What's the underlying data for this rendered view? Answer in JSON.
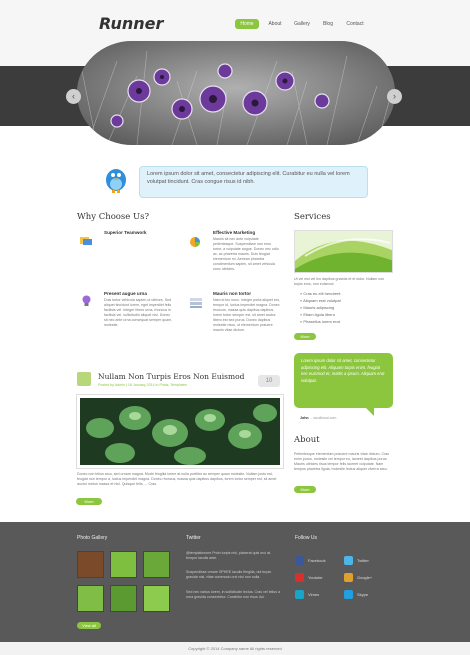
{
  "header": {
    "logo": "Runner",
    "nav": [
      "Home",
      "About",
      "Gallery",
      "Blog",
      "Contact"
    ]
  },
  "slider": {
    "prev": "‹",
    "next": "›"
  },
  "intro": "Lorem ipsum dolor sit amet, consectetur adipiscing elit. Curabitur eu nulla vel lorem volutpat tincidunt. Cras congue risus id nibh.",
  "why": {
    "heading": "Why Choose Us?",
    "features": [
      {
        "title": "Superior Teamwork",
        "text": ""
      },
      {
        "title": "Effective Marketing",
        "text": "Mauris sit nec ante vulputate pellentesque. Suspendisse non eros tortor, a vulputate augue. Donec nec odio ac, ac pharetra mauris. Duis feugiat elementum mi. Aenean pharetra condimentum sapien, sit amet vehicula nunc ultricies."
      },
      {
        "title": "Present augue urna",
        "text": "Duis tortor vehicula sapien ut ultrices. Sed aliquet tincidunt lorem, eget imperdiet felis facilisis vel. Integer libero urna, rhoncus in facilisis vel, sollicitudin aliquet nisi. Donec sit nec ante urna consequat semper quam, molestie."
      },
      {
        "title": "Mauris non tortor",
        "text": "Nam id leo nunc. Integer porta aliquet est, tempor id, luctus imperdiet magna. Donec rhoncus, massa quis dapibus dapibus, lorem tortor semper est, sit amet auctor libero est sed purus. Donec dapibus molestie risus, ut elementum posuere mauris vitae dictum."
      }
    ]
  },
  "post": {
    "title": "Nullam Non Turpis Eros Non Euismod",
    "meta": "Posted by Admin | 18 January 2014 in Posts, Templates",
    "comments": "10",
    "text": "Donec non tellus arcu, sed ornare magna. Morbi fringilla lorem at nulla porttitor ac semper quam molestie. Nullam justo est, feugiat non tempor a, luctus imperdiet magna. Donec rhoncus, massa quis dapibus dapibus, lorem tortor semper est, sit amet auctor metus massa et nisl. Quisque felis. ... Cras.",
    "more": "More"
  },
  "services": {
    "heading": "Services",
    "text": "Ut vel nisl vel leo dapibus gravida et et dolor. Nullam non turpis eros, non euismod.",
    "items": [
      "Cras eu elit hendrerit",
      "Aliquam erat volutpat",
      "Mauris adipiscing",
      "Etiam ligula libero",
      "Phasellus lorem erat"
    ],
    "more": "More"
  },
  "testimonial": {
    "quote": "Lorem ipsum dolor sit amet, consectetur adipiscing elit. Aliquam turpis enim, feugiat nec euismod et, mattis a ipsum. Aliquam erat volutpat.",
    "author": "John",
    "site": "- sicollinsal.com"
  },
  "about": {
    "heading": "About",
    "text": "Pellentesque elementum posuere mauris vitae dictum. Cras enim purus, molestie vel tempor eu, laoreet dapibus purus. Mauris ultricies risus tempor felis laoreet vulputate. Nam tempus pharetra ligula, molestie lectus aliquet viverra arcu.",
    "more": "More"
  },
  "footer": {
    "gallery_heading": "Photo Gallery",
    "view_all": "View all",
    "twitter_heading": "Twitter",
    "tweets": [
      "@templatezone Proin turpis nisl, placerat quis orci at, tempor iaculis ante.",
      "Suspendisse ornare SPHEE iaculis fringilla, dui turpis gravida nisi, vitae commodo orci nisl non nulla.",
      "Sed nec varius lorem, in sollicitudin lectus. Cras vel tellus a urna gravida consectetur. Curabitur non risus dui."
    ],
    "follow_heading": "Follow Us",
    "social": [
      {
        "label": "Facebook",
        "color": "#3b5998"
      },
      {
        "label": "Twitter",
        "color": "#4db6e8"
      },
      {
        "label": "Youtube",
        "color": "#d9302c"
      },
      {
        "label": "Google+",
        "color": "#e0a030"
      },
      {
        "label": "Vimeo",
        "color": "#1aa4c7"
      },
      {
        "label": "Skype",
        "color": "#20a0e0"
      }
    ]
  },
  "copyright": "Copyright © 2014 Company name All rights reserved"
}
